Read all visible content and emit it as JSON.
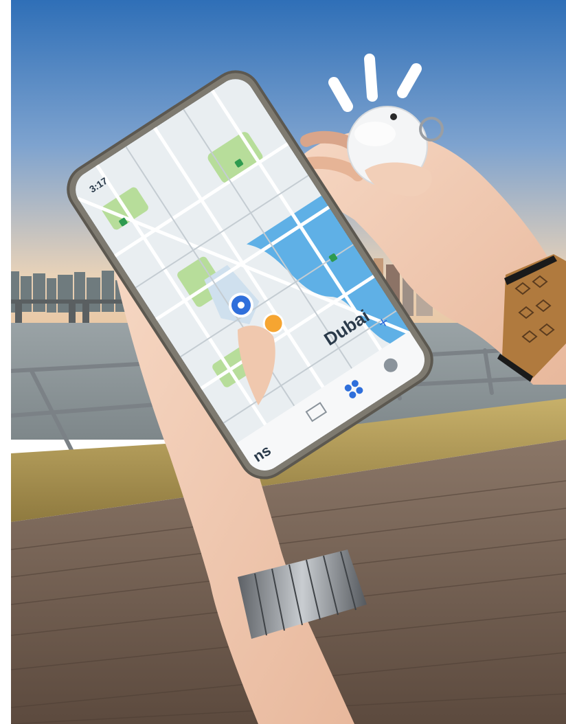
{
  "photo": {
    "phone": {
      "status_time": "3:17",
      "map_city_label": "Dubai",
      "tab_bar": {
        "partial_label": "ns",
        "add_symbol": "+"
      }
    },
    "colors": {
      "sky_top": "#2f6fb7",
      "sky_bottom": "#e8d2b8",
      "water": "#8d9498",
      "deck": "#6e5a4c",
      "map_land": "#e9eef1",
      "map_park": "#b7dd9a",
      "map_water": "#5fb0e6",
      "tag_white": "#f4f5f6"
    },
    "icons": [
      "location-pin-icon",
      "tag-tracker-icon",
      "watch-icon",
      "bracelet-icon"
    ]
  }
}
